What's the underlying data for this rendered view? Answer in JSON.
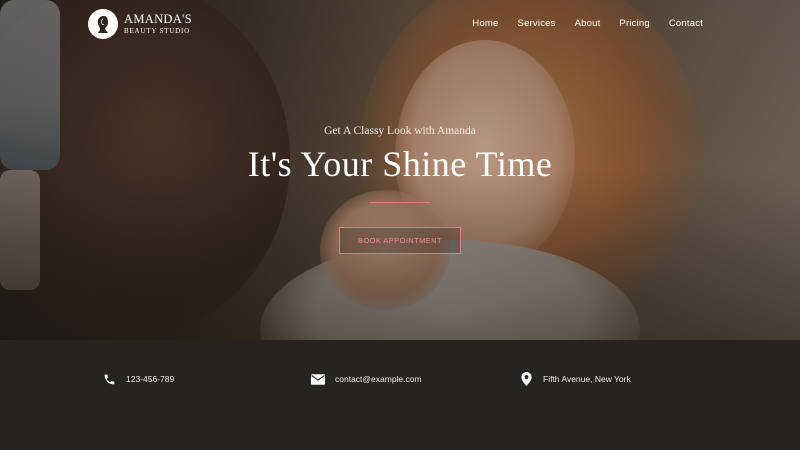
{
  "brand": {
    "name": "AMANDA'S",
    "subtitle": "BEAUTY STUDIO",
    "logo_icon": "woman-silhouette-icon"
  },
  "nav": {
    "items": [
      "Home",
      "Services",
      "About",
      "Pricing",
      "Contact"
    ]
  },
  "hero": {
    "tagline": "Get A Classy Look with Amanda",
    "headline": "It's Your Shine Time",
    "cta_label": "BOOK APPOINTMENT",
    "accent_color": "#e47b8c"
  },
  "contact": {
    "phone": "123-456-789",
    "email": "contact@example.com",
    "address": "Fifth Avenue, New York",
    "icons": [
      "phone-icon",
      "mail-icon",
      "location-pin-icon"
    ]
  }
}
